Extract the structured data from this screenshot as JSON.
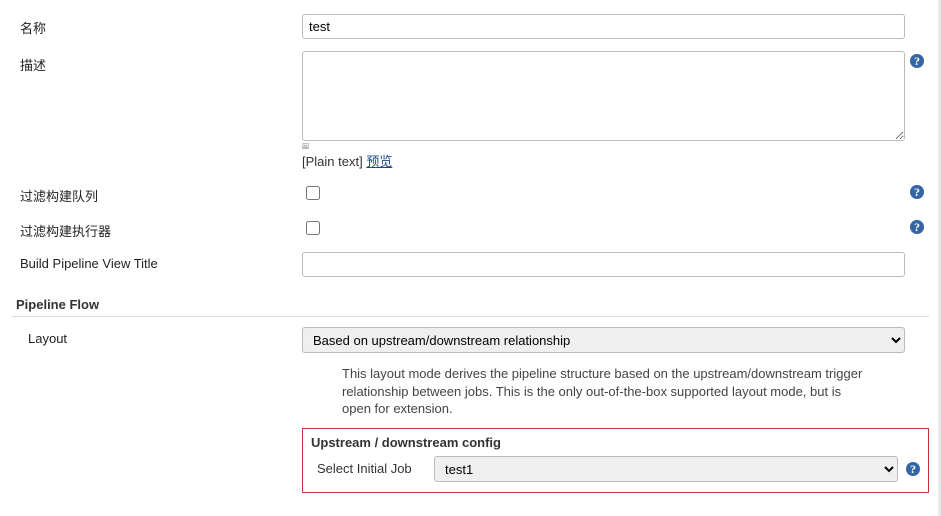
{
  "form": {
    "name": {
      "label": "名称",
      "value": "test"
    },
    "description": {
      "label": "描述",
      "value": "",
      "plain_prefix": "[Plain text] ",
      "preview_link": "预览"
    },
    "filter_queue": {
      "label": "过滤构建队列"
    },
    "filter_executors": {
      "label": "过滤构建执行器"
    },
    "view_title": {
      "label": "Build Pipeline View Title",
      "value": ""
    }
  },
  "pipeline": {
    "section_title": "Pipeline Flow",
    "layout": {
      "label": "Layout",
      "selected": "Based on upstream/downstream relationship",
      "help_text": "This layout mode derives the pipeline structure based on the upstream/downstream trigger relationship between jobs. This is the only out-of-the-box supported layout mode, but is open for extension."
    },
    "config": {
      "box_title": "Upstream / downstream config",
      "initial_job": {
        "label": "Select Initial Job",
        "selected": "test1"
      }
    }
  },
  "help_glyph": "?"
}
